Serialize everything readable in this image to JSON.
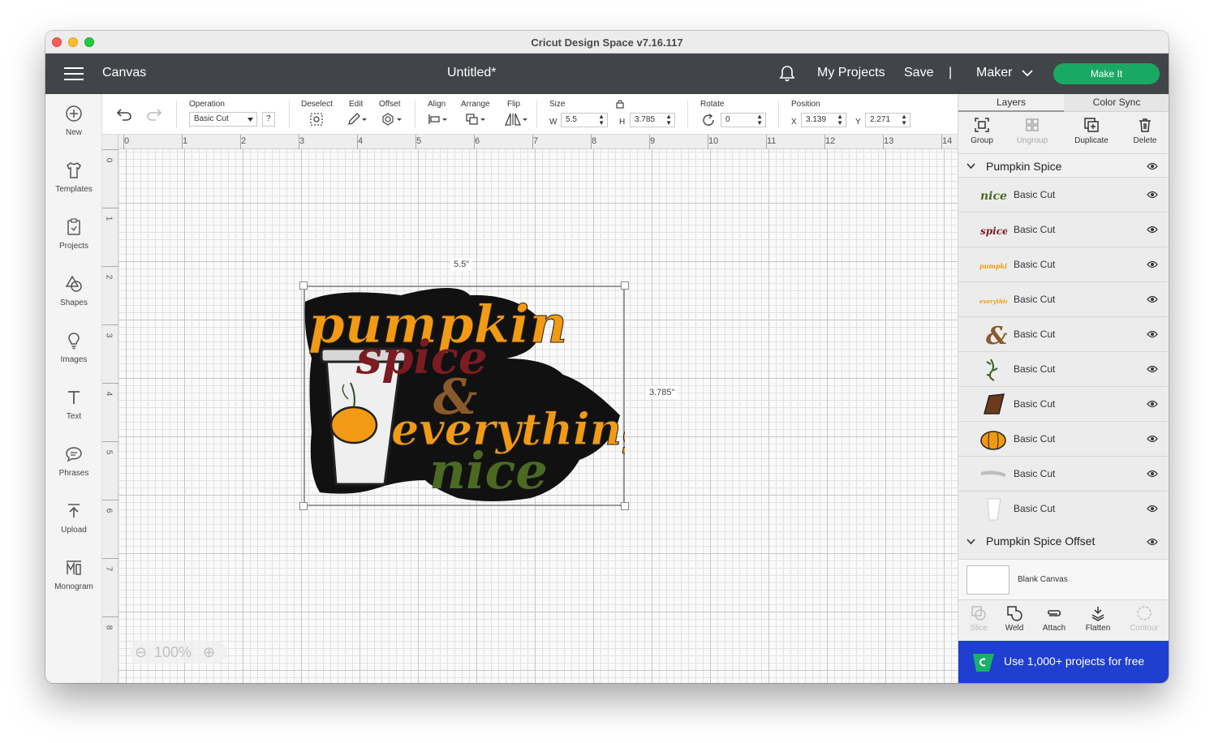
{
  "window": {
    "title": "Cricut Design Space  v7.16.117"
  },
  "topbar": {
    "canvas_label": "Canvas",
    "document_title": "Untitled*",
    "my_projects": "My Projects",
    "save": "Save",
    "separator": "|",
    "machine": "Maker",
    "make_it": "Make It"
  },
  "leftbar": [
    {
      "label": "New"
    },
    {
      "label": "Templates"
    },
    {
      "label": "Projects"
    },
    {
      "label": "Shapes"
    },
    {
      "label": "Images"
    },
    {
      "label": "Text"
    },
    {
      "label": "Phrases"
    },
    {
      "label": "Upload"
    },
    {
      "label": "Monogram"
    }
  ],
  "toolbar": {
    "operation_label": "Operation",
    "operation_value": "Basic Cut",
    "help": "?",
    "deselect": "Deselect",
    "edit": "Edit",
    "offset": "Offset",
    "align": "Align",
    "arrange": "Arrange",
    "flip": "Flip",
    "size": "Size",
    "w_label": "W",
    "w_value": "5.5",
    "h_label": "H",
    "h_value": "3.785",
    "rotate": "Rotate",
    "rotate_value": "0",
    "position": "Position",
    "x_label": "X",
    "x_value": "3.139",
    "y_label": "Y",
    "y_value": "2.271"
  },
  "canvas": {
    "ruler_top": [
      "0",
      "1",
      "2",
      "3",
      "4",
      "5",
      "6",
      "7",
      "8",
      "9",
      "10",
      "11",
      "12",
      "13",
      "14"
    ],
    "ruler_left": [
      "0",
      "1",
      "2",
      "3",
      "4",
      "5",
      "6",
      "7",
      "8"
    ],
    "width_label": "5.5\"",
    "height_label": "3.785\"",
    "zoom": "100%",
    "art_text": [
      "pumpkin",
      "spice",
      "&",
      "everything",
      "nice"
    ]
  },
  "panel": {
    "tab_layers": "Layers",
    "tab_color_sync": "Color Sync",
    "tools": {
      "group": "Group",
      "ungroup": "Ungroup",
      "duplicate": "Duplicate",
      "delete": "Delete"
    },
    "group_title": "Pumpkin Spice",
    "layers": [
      {
        "label": "Basic Cut",
        "thumb": "nice",
        "color": "#4a6a22"
      },
      {
        "label": "Basic Cut",
        "thumb": "spice",
        "color": "#7a1c22"
      },
      {
        "label": "Basic Cut",
        "thumb": "pumpkin",
        "color": "#f09a12"
      },
      {
        "label": "Basic Cut",
        "thumb": "everything",
        "color": "#f09a12"
      },
      {
        "label": "Basic Cut",
        "thumb": "ampersand",
        "color": "#8a5a2a"
      },
      {
        "label": "Basic Cut",
        "thumb": "vine",
        "color": "#3d5a22"
      },
      {
        "label": "Basic Cut",
        "thumb": "sleeve",
        "color": "#6a3a1a"
      },
      {
        "label": "Basic Cut",
        "thumb": "pumpkin-fruit",
        "color": "#f09a12"
      },
      {
        "label": "Basic Cut",
        "thumb": "lid",
        "color": "#bdbdbd"
      },
      {
        "label": "Basic Cut",
        "thumb": "cup",
        "color": "#ffffff"
      }
    ],
    "offset_group_title": "Pumpkin Spice Offset",
    "blank_canvas": "Blank Canvas",
    "bottom_tools": {
      "slice": "Slice",
      "weld": "Weld",
      "attach": "Attach",
      "flatten": "Flatten",
      "contour": "Contour"
    },
    "promo": "Use 1,000+ projects for free"
  },
  "colors": {
    "make_it": "#1aa964",
    "topbar": "#414549",
    "promo": "#1f3fd0"
  }
}
